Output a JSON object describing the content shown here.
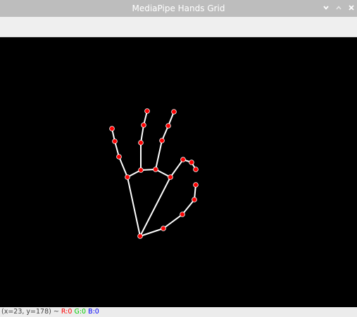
{
  "window": {
    "title": "MediaPipe Hands Grid",
    "minimize_icon": "chevron-down-icon",
    "maximize_icon": "chevron-up-icon",
    "close_icon": "close-icon"
  },
  "canvas": {
    "background": "#000000",
    "landmark_color": "#ff0000",
    "connection_color": "#ffffff",
    "landmark_count": 21
  },
  "status": {
    "coords": "(x=23, y=178) ~",
    "r_label": "R:0",
    "g_label": "G:0",
    "b_label": "B:0"
  }
}
